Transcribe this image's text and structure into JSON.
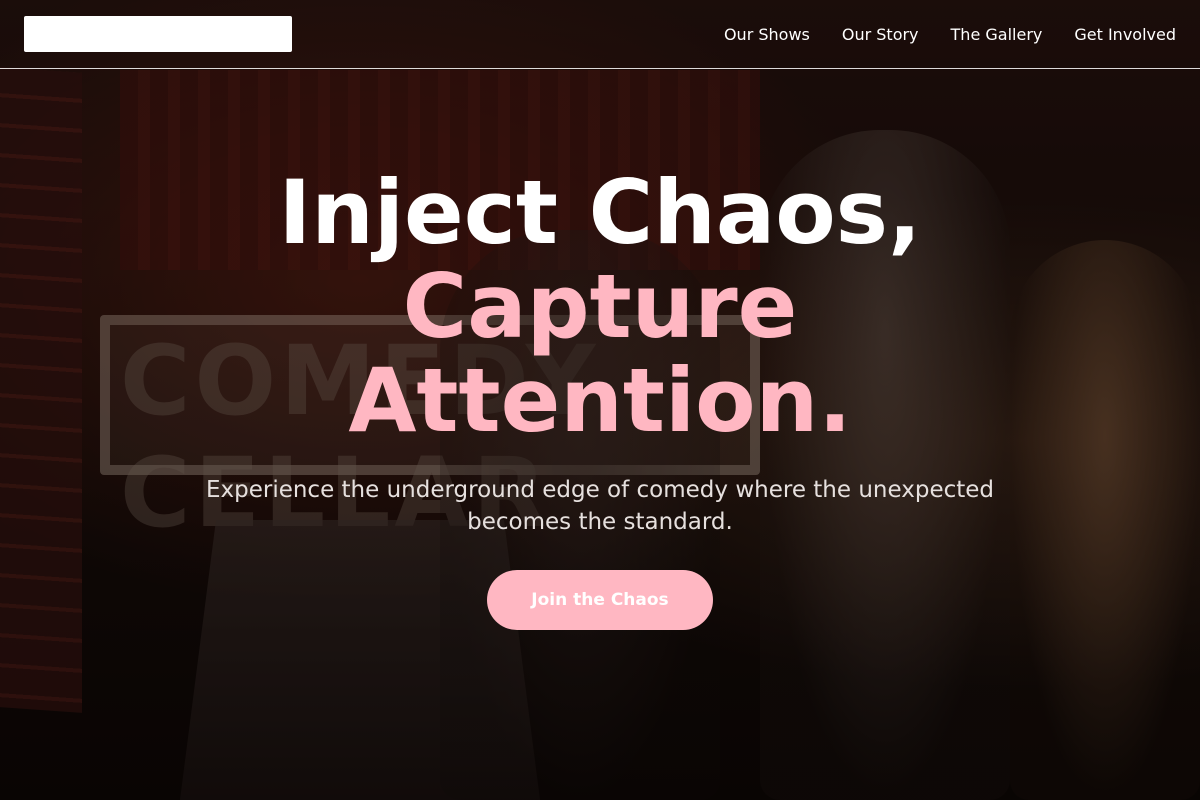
{
  "nav": {
    "logo_alt": "",
    "links": [
      {
        "label": "Our Shows"
      },
      {
        "label": "Our Story"
      },
      {
        "label": "The Gallery"
      },
      {
        "label": "Get Involved"
      }
    ]
  },
  "hero": {
    "headline_line1": "Inject Chaos,",
    "headline_line2": "Capture",
    "headline_line3": "Attention.",
    "subtitle": "Experience the underground edge of comedy where the unexpected becomes the standard.",
    "cta_label": "Join the Chaos",
    "backdrop_sign": "COMEDY CELLAR"
  },
  "colors": {
    "accent_pink": "#ffb7c2",
    "text_white": "#ffffff",
    "subtitle_text": "#e6e0de"
  }
}
